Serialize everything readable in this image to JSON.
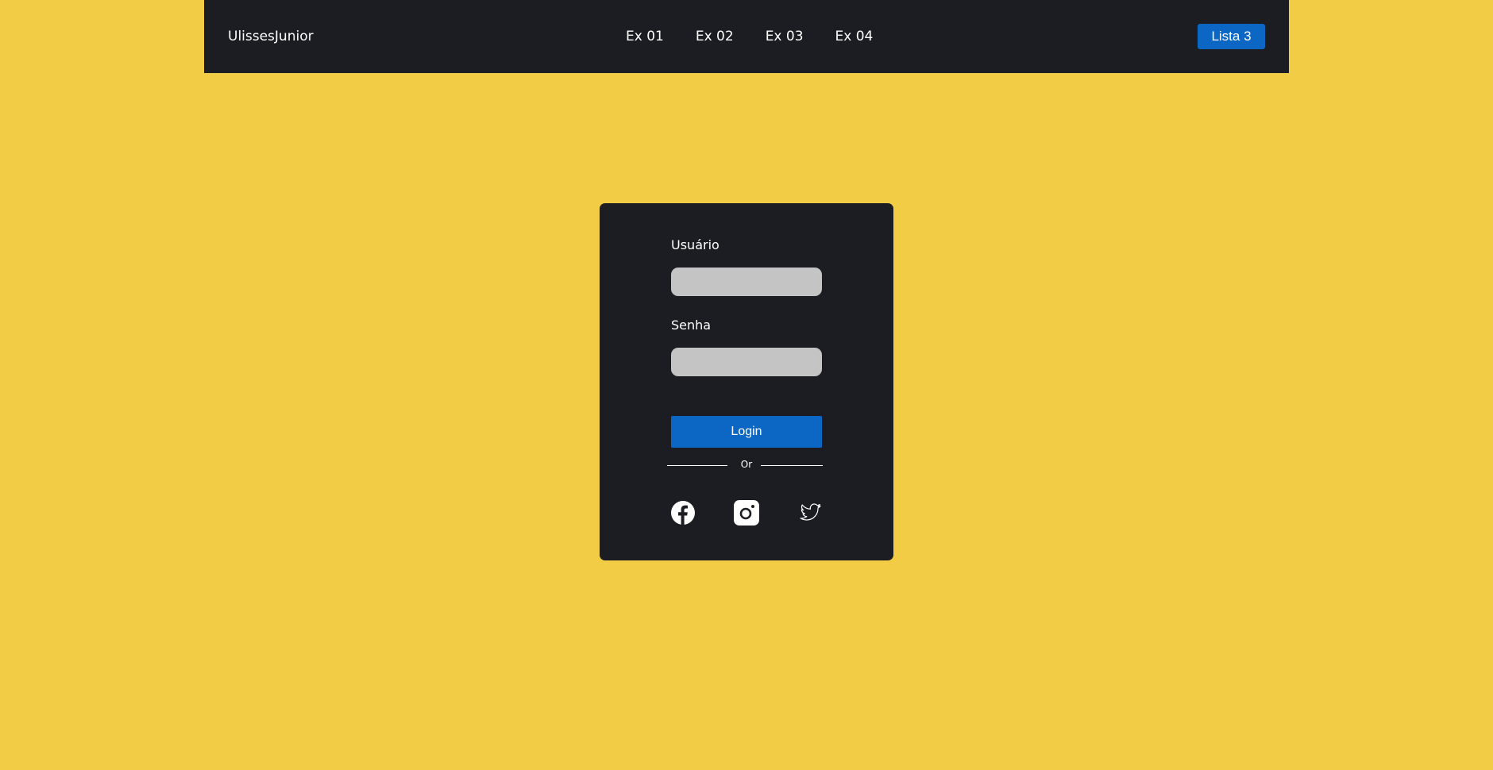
{
  "navbar": {
    "brand": "UlissesJunior",
    "links": [
      "Ex 01",
      "Ex 02",
      "Ex 03",
      "Ex 04"
    ],
    "button_label": "Lista 3"
  },
  "login": {
    "user_label": "Usuário",
    "user_value": "",
    "password_label": "Senha",
    "password_value": "",
    "button_label": "Login",
    "divider_text": "Or",
    "social": [
      "facebook-icon",
      "instagram-icon",
      "twitter-icon"
    ]
  },
  "colors": {
    "background": "#f2cc44",
    "surface": "#1c1d22",
    "accent": "#0c67c4",
    "input": "#c4c4c4"
  }
}
